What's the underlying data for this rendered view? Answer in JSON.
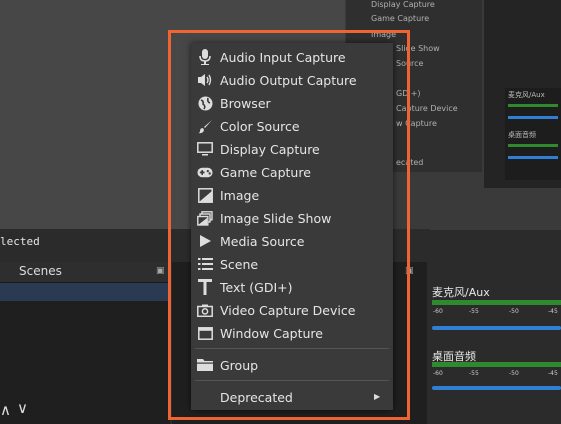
{
  "status": {
    "no_source_text": "lected"
  },
  "scenes": {
    "title": "Scenes"
  },
  "mixer": {
    "channels": [
      {
        "name": "麦克风/Aux",
        "scale": [
          "-60",
          "-55",
          "-50",
          "-45"
        ]
      },
      {
        "name": "桌面音频",
        "scale": [
          "-60",
          "-55",
          "-50",
          "-45"
        ]
      }
    ]
  },
  "ghost_menu": {
    "items": [
      "Display Capture",
      "Game Capture",
      "Image",
      "Slide Show",
      "Source",
      "GDI+)",
      "Capture Device",
      "w Capture",
      "ecated"
    ],
    "mixer": [
      "麦克风/Aux",
      "桌面音频"
    ]
  },
  "context_menu": {
    "items": [
      {
        "label": "Audio Input Capture",
        "icon": "microphone-icon"
      },
      {
        "label": "Audio Output Capture",
        "icon": "speaker-icon"
      },
      {
        "label": "Browser",
        "icon": "globe-icon"
      },
      {
        "label": "Color Source",
        "icon": "brush-icon"
      },
      {
        "label": "Display Capture",
        "icon": "monitor-icon"
      },
      {
        "label": "Game Capture",
        "icon": "gamepad-icon"
      },
      {
        "label": "Image",
        "icon": "image-icon"
      },
      {
        "label": "Image Slide Show",
        "icon": "slideshow-icon"
      },
      {
        "label": "Media Source",
        "icon": "play-icon"
      },
      {
        "label": "Scene",
        "icon": "list-icon"
      },
      {
        "label": "Text (GDI+)",
        "icon": "text-icon"
      },
      {
        "label": "Video Capture Device",
        "icon": "camera-icon"
      },
      {
        "label": "Window Capture",
        "icon": "window-icon"
      }
    ],
    "group_label": "Group",
    "deprecated_label": "Deprecated"
  },
  "colors": {
    "highlight": "#ee6433",
    "menu_bg": "#3a3a3a",
    "meter_green": "#2f8a2f",
    "meter_blue": "#2f7fd4"
  }
}
